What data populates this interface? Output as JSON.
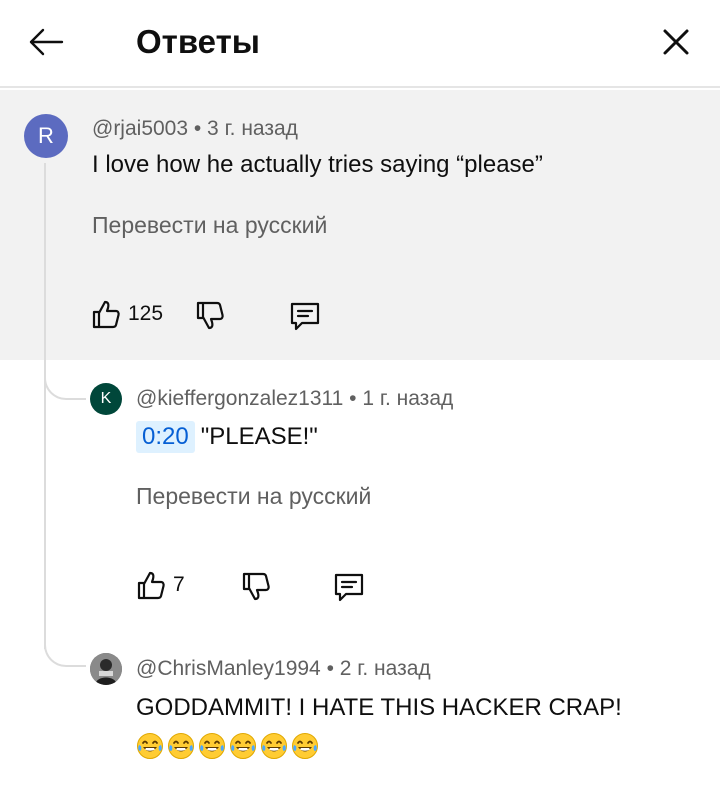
{
  "header": {
    "title": "Ответы",
    "back_icon": "arrow-left-icon",
    "close_icon": "close-icon"
  },
  "comments": [
    {
      "avatar_letter": "R",
      "avatar_color": "#5c6bc0",
      "meta": "@rjai5003 • 3 г. назад",
      "text": "I love how he actually tries saying “please”",
      "translate": "Перевести на русский",
      "likes": "125"
    },
    {
      "avatar_letter": "K",
      "avatar_color": "#00473a",
      "meta": "@kieffergonzalez1311 • 1 г. назад",
      "timestamp": "0:20",
      "text": "\"PLEASE!\"",
      "translate": "Перевести на русский",
      "likes": "7"
    },
    {
      "avatar_letter": "",
      "avatar_color": "#555555",
      "meta": "@ChrisManley1994 • 2 г. назад",
      "text": "GODDAMMIT! I HATE THIS HACKER CRAP!",
      "emoji": "😂😂😂😂😂😂"
    }
  ]
}
